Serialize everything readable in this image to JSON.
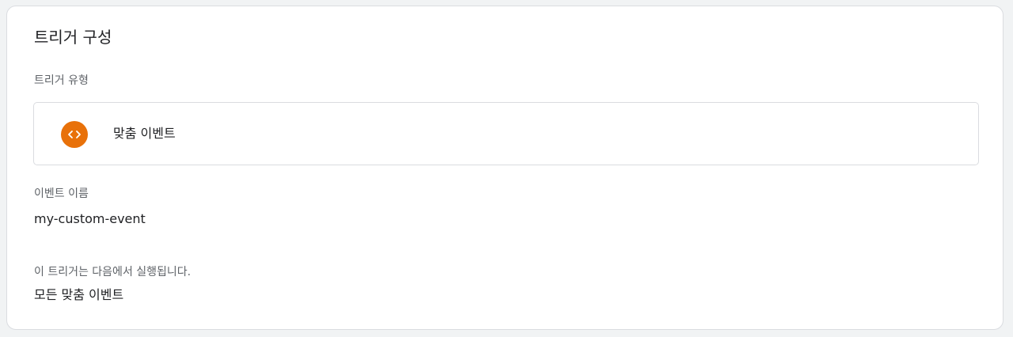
{
  "trigger_config": {
    "title": "트리거 구성",
    "type_label": "트리거 유형",
    "type": {
      "name": "맞춤 이벤트",
      "icon": "code-brackets-icon",
      "icon_color": "#e8710a"
    },
    "event_name_label": "이벤트 이름",
    "event_name_value": "my-custom-event",
    "fires_on_label": "이 트리거는 다음에서 실행됩니다.",
    "fires_on_value": "모든 맞춤 이벤트"
  }
}
